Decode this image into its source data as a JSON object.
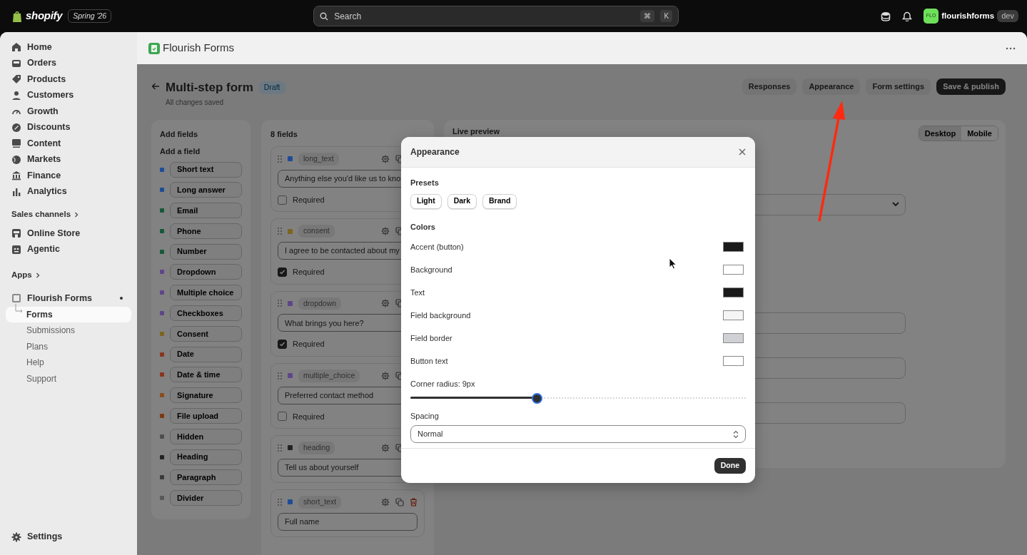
{
  "topbar": {
    "logo": "shopify",
    "edition": "Spring '26",
    "search": {
      "placeholder": "Search",
      "keys": [
        "⌘",
        "K"
      ]
    },
    "store": {
      "initials": "FLO",
      "name": "flourishforms",
      "badge": "dev"
    }
  },
  "sidebar": {
    "items": [
      {
        "label": "Home",
        "selected": false
      },
      {
        "label": "Orders",
        "selected": false
      },
      {
        "label": "Products",
        "selected": false
      },
      {
        "label": "Customers",
        "selected": false
      },
      {
        "label": "Growth",
        "selected": false
      },
      {
        "label": "Discounts",
        "selected": false
      },
      {
        "label": "Content",
        "selected": false
      },
      {
        "label": "Markets",
        "selected": false
      },
      {
        "label": "Finance",
        "selected": false
      },
      {
        "label": "Analytics",
        "selected": false
      }
    ],
    "sales_channels": {
      "title": "Sales channels",
      "items": [
        {
          "label": "Online Store",
          "selected": false
        },
        {
          "label": "Agentic",
          "selected": false
        }
      ]
    },
    "apps": {
      "title": "Apps",
      "app": {
        "label": "Flourish Forms",
        "children": [
          {
            "label": "Forms",
            "selected": true
          },
          {
            "label": "Submissions",
            "selected": false
          },
          {
            "label": "Plans",
            "selected": false
          },
          {
            "label": "Help",
            "selected": false
          },
          {
            "label": "Support",
            "selected": false
          }
        ]
      }
    },
    "settings": {
      "label": "Settings"
    }
  },
  "app_header": {
    "title": "Flourish Forms"
  },
  "page": {
    "title": "Multi-step form",
    "status": "Draft",
    "subtitle": "All changes saved",
    "actions": [
      {
        "label": "Responses",
        "kind": "secondary"
      },
      {
        "label": "Appearance",
        "kind": "secondary"
      },
      {
        "label": "Form settings",
        "kind": "secondary"
      },
      {
        "label": "Save & publish",
        "kind": "primary"
      }
    ]
  },
  "add_fields": {
    "title": "Add fields",
    "subtitle": "Add a field",
    "items": [
      {
        "label": "Short text",
        "color": "#1f4c96"
      },
      {
        "label": "Long answer",
        "color": "#1f4c96"
      },
      {
        "label": "Email",
        "color": "#17573a"
      },
      {
        "label": "Phone",
        "color": "#17573a"
      },
      {
        "label": "Number",
        "color": "#17573a"
      },
      {
        "label": "Dropdown",
        "color": "#5f4689"
      },
      {
        "label": "Multiple choice",
        "color": "#5f4689"
      },
      {
        "label": "Checkboxes",
        "color": "#5f4689"
      },
      {
        "label": "Consent",
        "color": "#7d6420"
      },
      {
        "label": "Date",
        "color": "#8a3520"
      },
      {
        "label": "Date & time",
        "color": "#8a3520"
      },
      {
        "label": "Signature",
        "color": "#8c4c1d"
      },
      {
        "label": "File upload",
        "color": "#7e3913"
      },
      {
        "label": "Hidden",
        "color": "#4e4e4e"
      },
      {
        "label": "Heading",
        "color": "#222222"
      },
      {
        "label": "Paragraph",
        "color": "#3b3b3b"
      },
      {
        "label": "Divider",
        "color": "#585858"
      }
    ]
  },
  "fields": {
    "title": "8 fields",
    "items": [
      {
        "type": "long_text",
        "color": "#1f4c96",
        "value": "Anything else you'd like us to kno",
        "required": {
          "label": "Required",
          "checked": false
        }
      },
      {
        "type": "consent",
        "color": "#7d6420",
        "value": "I agree to be contacted about my",
        "required": {
          "label": "Required",
          "checked": true
        }
      },
      {
        "type": "dropdown",
        "color": "#5f4689",
        "value": "What brings you here?",
        "required": {
          "label": "Required",
          "checked": true
        }
      },
      {
        "type": "multiple_choice",
        "color": "#5f4689",
        "value": "Preferred contact method",
        "required": {
          "label": "Required",
          "checked": false
        }
      },
      {
        "type": "heading",
        "color": "#222222",
        "value": "Tell us about yourself"
      },
      {
        "type": "short_text",
        "color": "#1f4c96",
        "value": "Full name",
        "show_delete": true
      }
    ]
  },
  "preview": {
    "title": "Live preview",
    "views": [
      {
        "label": "Desktop",
        "selected": true
      },
      {
        "label": "Mobile",
        "selected": false
      }
    ],
    "fields": [
      {
        "kind": "select"
      },
      {
        "kind": "input"
      },
      {
        "kind": "input"
      },
      {
        "kind": "input"
      }
    ]
  },
  "modal": {
    "title": "Appearance",
    "presets_label": "Presets",
    "presets": [
      "Light",
      "Dark",
      "Brand"
    ],
    "colors_label": "Colors",
    "colors": [
      {
        "label": "Accent (button)",
        "color": "#1a1a1a"
      },
      {
        "label": "Background",
        "color": "#ffffff"
      },
      {
        "label": "Text",
        "color": "#1a1a1a"
      },
      {
        "label": "Field background",
        "color": "#f5f5f5"
      },
      {
        "label": "Field border",
        "color": "#cfd1d4"
      },
      {
        "label": "Button text",
        "color": "#ffffff"
      }
    ],
    "radius": {
      "label": "Corner radius: 9px",
      "level": 0.377
    },
    "spacing": {
      "label": "Spacing",
      "value": "Normal"
    },
    "done": "Done"
  }
}
